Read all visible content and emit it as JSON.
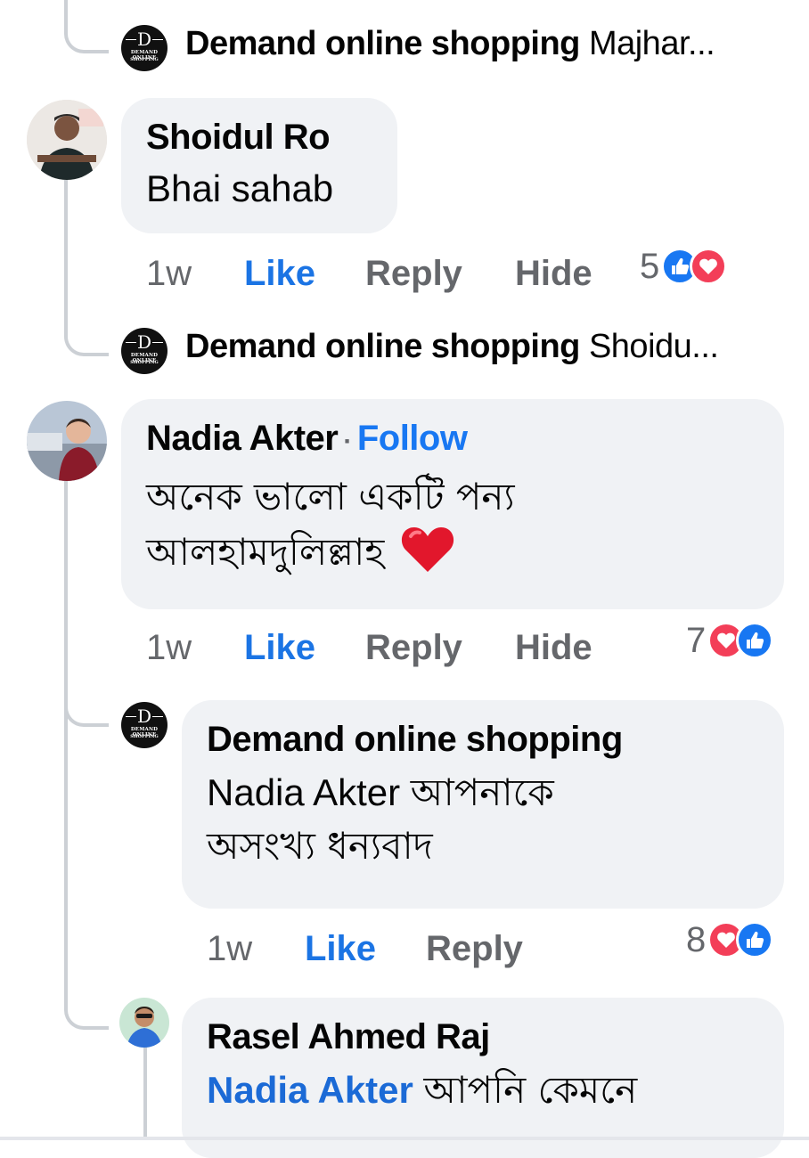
{
  "collapsed_replies": [
    {
      "author": "Demand online shopping",
      "preview": "Majhar..."
    },
    {
      "author": "Demand online shopping",
      "preview": "Shoidu..."
    }
  ],
  "page_avatar": {
    "letter": "D",
    "line1": "DEMAND ONLINE",
    "line2": "SHOPPING"
  },
  "comments": [
    {
      "author": "Shoidul Ro",
      "text": "Bhai sahab",
      "time": "1w",
      "like": "Like",
      "reply": "Reply",
      "hide": "Hide",
      "reaction_count": "5",
      "reactions": [
        "like-icon",
        "love-icon"
      ]
    },
    {
      "author": "Nadia Akter",
      "follow_sep": "·",
      "follow": "Follow",
      "line1": "অনেক ভালো একটি পন্য",
      "line2": "আলহামদুলিল্লাহ",
      "emoji": "❤️",
      "time": "1w",
      "like": "Like",
      "reply": "Reply",
      "hide": "Hide",
      "reaction_count": "7",
      "reactions": [
        "love-icon",
        "like-icon"
      ]
    },
    {
      "author": "Demand online shopping",
      "mention": "Nadia Akter",
      "line1_rest": "আপনাকে",
      "line2": "অসংখ্য ধন্যবাদ",
      "time": "1w",
      "like": "Like",
      "reply": "Reply",
      "reaction_count": "8",
      "reactions": [
        "love-icon",
        "like-icon"
      ]
    },
    {
      "author": "Rasel Ahmed Raj",
      "mention": "Nadia Akter",
      "line1_rest": "আপনি কেমনে"
    }
  ],
  "colors": {
    "bubble": "#f0f2f5",
    "link": "#1877f2",
    "meta": "#65676b",
    "love": "#f33e58",
    "like": "#1877f2"
  }
}
